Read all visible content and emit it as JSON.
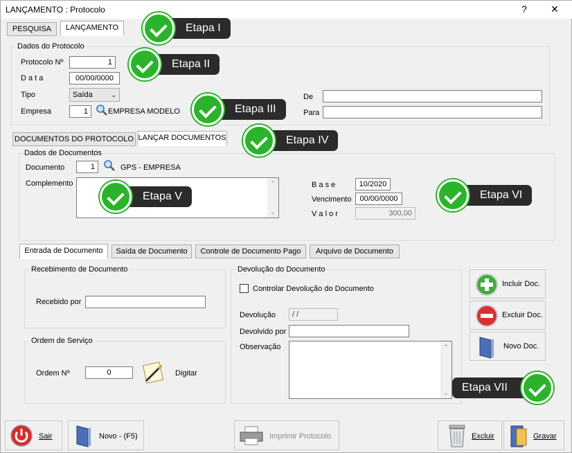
{
  "window": {
    "title": "LANÇAMENTO : Protocolo",
    "help": "?",
    "close": "✕"
  },
  "top_tabs": [
    {
      "label": "PESQUISA"
    },
    {
      "label": "LANÇAMENTO"
    }
  ],
  "protocolo": {
    "group_label": "Dados do Protocolo",
    "protocolo_label": "Protocolo Nº",
    "protocolo_value": "1",
    "data_label": "D a t a",
    "data_value": "00/00/0000",
    "tipo_label": "Tipo",
    "tipo_value": "Saída",
    "empresa_label": "Empresa",
    "empresa_value": "1",
    "empresa_name": "EMPRESA MODELO",
    "de_label": "De",
    "de_value": "",
    "para_label": "Para",
    "para_value": ""
  },
  "mid_tabs": [
    {
      "label": "DOCUMENTOS DO PROTOCOLO"
    },
    {
      "label": "LANÇAR DOCUMENTOS"
    }
  ],
  "documentos": {
    "group_label": "Dados de Documentos",
    "documento_label": "Documento",
    "documento_value": "1",
    "documento_name": "GPS - EMPRESA",
    "complemento_label": "Complemento",
    "base_label": "B a s e",
    "base_value": "10/2020",
    "vencimento_label": "Vencimento",
    "vencimento_value": "00/00/0000",
    "valor_label": "V a l o r",
    "valor_value": "300,00"
  },
  "doc_tabs": [
    {
      "label": "Entrada de Documento"
    },
    {
      "label": "Saída de Documento"
    },
    {
      "label": "Controle de Documento Pago"
    },
    {
      "label": "Arquivo de Documento"
    }
  ],
  "recebimento": {
    "group_label": "Recebimento de Documento",
    "recebido_label": "Recebido por",
    "recebido_value": ""
  },
  "ordem": {
    "group_label": "Ordem de Serviço",
    "ordem_label": "Ordem Nº",
    "ordem_value": "0",
    "digitar_label": "Digitar"
  },
  "devolucao": {
    "group_label": "Devolução do Documento",
    "controlar_label": "Controlar Devolução do Documento",
    "devolucao_label": "Devolução",
    "devolucao_value": "  /  /",
    "devolvido_label": "Devolvido por",
    "devolvido_value": "",
    "observacao_label": "Observação"
  },
  "side_buttons": {
    "incluir": "Incluir Doc.",
    "excluir": "Excluir Doc.",
    "novo": "Novo Doc."
  },
  "bottom_buttons": {
    "sair": "Sair",
    "novo": "Novo - (F5)",
    "imprimir": "Imprimir Protocolo",
    "excluir": "Excluir",
    "gravar": "Gravar"
  },
  "callouts": [
    "Etapa I",
    "Etapa II",
    "Etapa III",
    "Etapa IV",
    "Etapa V",
    "Etapa VI",
    "Etapa VII"
  ],
  "colors": {
    "callout_bg": "#2b2b2b",
    "check_green": "#2bb32b",
    "window_bg": "#f0f0f0"
  }
}
